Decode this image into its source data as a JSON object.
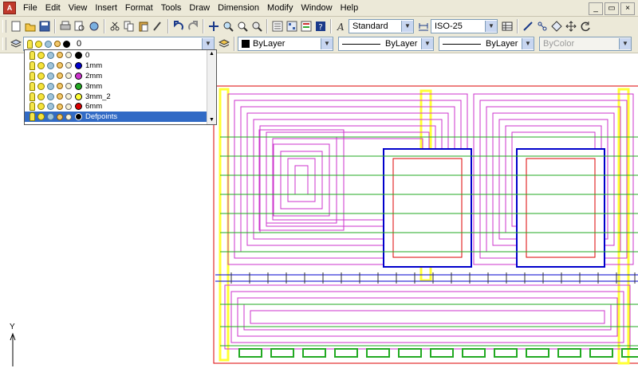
{
  "menubar": {
    "app_icon": "A",
    "items": [
      "File",
      "Edit",
      "View",
      "Insert",
      "Format",
      "Tools",
      "Draw",
      "Dimension",
      "Modify",
      "Window",
      "Help"
    ]
  },
  "window_buttons": {
    "minimize": "_",
    "restore": "▭",
    "close": "×"
  },
  "toolbar_icons": [
    "new-icon",
    "open-icon",
    "save-icon",
    "print-icon",
    "preview-icon",
    "publish-icon",
    "cut-icon",
    "copy-icon",
    "paste-icon",
    "match-icon",
    "undo-icon",
    "redo-icon",
    "pan-icon",
    "zoom-realtime-icon",
    "zoom-window-icon",
    "zoom-previous-icon",
    "properties-icon",
    "design-center-icon",
    "tool-palettes-icon",
    "help-icon"
  ],
  "styles": {
    "text_style": "Standard",
    "dim_style": "ISO-25"
  },
  "layers_combo": {
    "current": "0"
  },
  "properties": {
    "color": "ByLayer",
    "linetype": "ByLayer",
    "lineweight": "ByLayer",
    "plotstyle": "ByColor"
  },
  "layer_list": [
    {
      "name": "0",
      "color": "#000000"
    },
    {
      "name": "1mm",
      "color": "#0000cc"
    },
    {
      "name": "2mm",
      "color": "#cc33cc"
    },
    {
      "name": "3mm",
      "color": "#22aa22"
    },
    {
      "name": "3mm_2",
      "color": "#ffff33"
    },
    {
      "name": "6mm",
      "color": "#dd0000"
    },
    {
      "name": "Defpoints",
      "color": "#000000",
      "selected": true
    }
  ],
  "colors": {
    "heating_pipe": "#cc33cc",
    "joist": "#22aa22",
    "column": "#ffff33",
    "wall": "#dd0000",
    "window": "#0000cc"
  },
  "ucs": {
    "y_label": "Y"
  }
}
